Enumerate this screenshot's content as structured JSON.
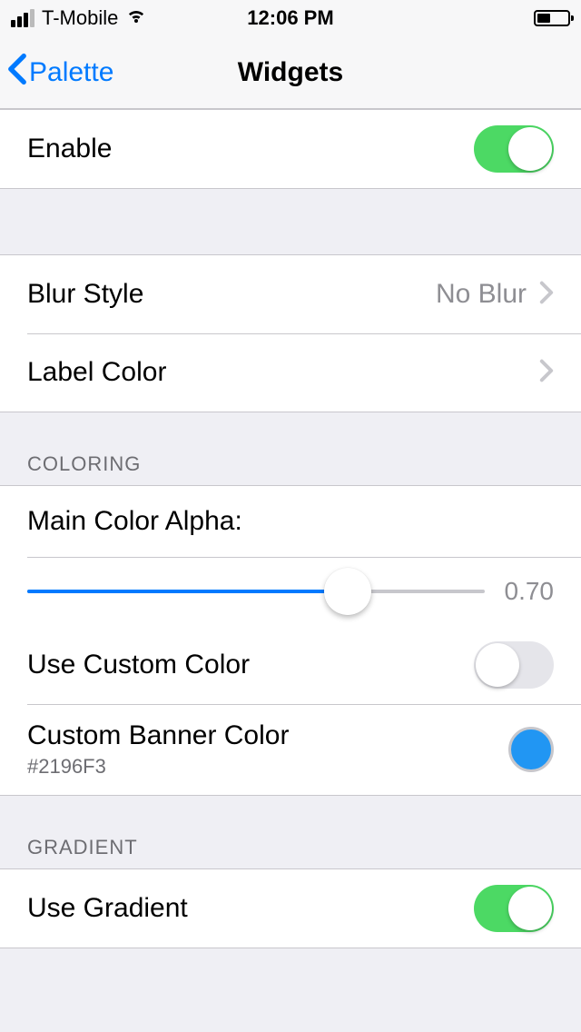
{
  "statusBar": {
    "carrier": "T-Mobile",
    "time": "12:06 PM"
  },
  "nav": {
    "back": "Palette",
    "title": "Widgets"
  },
  "enable": {
    "label": "Enable",
    "on": true
  },
  "style": {
    "blurStyle": {
      "label": "Blur Style",
      "value": "No Blur"
    },
    "labelColor": {
      "label": "Label Color"
    }
  },
  "coloring": {
    "header": "COLORING",
    "mainAlpha": {
      "label": "Main Color Alpha:",
      "value": 0.7,
      "display": "0.70"
    },
    "useCustom": {
      "label": "Use Custom Color",
      "on": false
    },
    "bannerColor": {
      "label": "Custom Banner Color",
      "hex": "#2196F3"
    }
  },
  "gradient": {
    "header": "GRADIENT",
    "useGradient": {
      "label": "Use Gradient",
      "on": true
    }
  }
}
